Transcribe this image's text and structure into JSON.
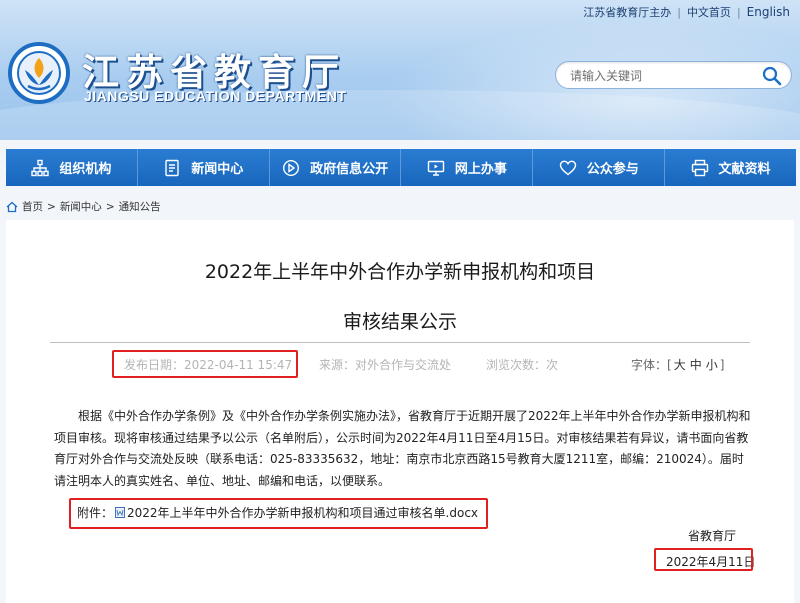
{
  "header": {
    "top_links": [
      "江苏省教育厅主办",
      "中文首页",
      "English"
    ],
    "title": "江苏省教育厅",
    "subtitle": "JIANGSU EDUCATION DEPARTMENT",
    "search_placeholder": "请输入关键词"
  },
  "nav": {
    "items": [
      {
        "label": "组织机构",
        "icon": "org-chart-icon"
      },
      {
        "label": "新闻中心",
        "icon": "document-icon"
      },
      {
        "label": "政府信息公开",
        "icon": "public-info-icon"
      },
      {
        "label": "网上办事",
        "icon": "monitor-icon"
      },
      {
        "label": "公众参与",
        "icon": "heart-icon"
      },
      {
        "label": "文献资料",
        "icon": "printer-icon"
      }
    ]
  },
  "breadcrumb": {
    "home": "首页",
    "sep1": ">",
    "news": "新闻中心",
    "sep2": ">",
    "current": "通知公告"
  },
  "article": {
    "title_line1": "2022年上半年中外合作办学新申报机构和项目",
    "title_line2": "审核结果公示",
    "meta": {
      "publish": "发布日期：2022-04-11 15:47",
      "source": "来源：对外合作与交流处",
      "views": "浏览次数：次",
      "font_label": "字体：[",
      "font_large": "大",
      "font_medium": "中",
      "font_small": "小",
      "font_end": "]"
    },
    "body": "根据《中外合作办学条例》及《中外合作办学条例实施办法》，省教育厅于近期开展了2022年上半年中外合作办学新申报机构和项目审核。现将审核通过结果予以公示（名单附后），公示时间为2022年4月11日至4月15日。对审核结果若有异议，请书面向省教育厅对外合作与交流处反映（联系电话：025-83335632，地址：南京市北京西路15号教育大厦1211室，邮编：210024）。届时请注明本人的真实姓名、单位、地址、邮编和电话，以便联系。",
    "attachment_label": "附件：",
    "attachment_file": "2022年上半年中外合作办学新申报机构和项目通过审核名单.docx",
    "signature": "省教育厅",
    "date": "2022年4月11日"
  },
  "colors": {
    "nav": "#1d6fc6",
    "highlight": "#e02020"
  }
}
